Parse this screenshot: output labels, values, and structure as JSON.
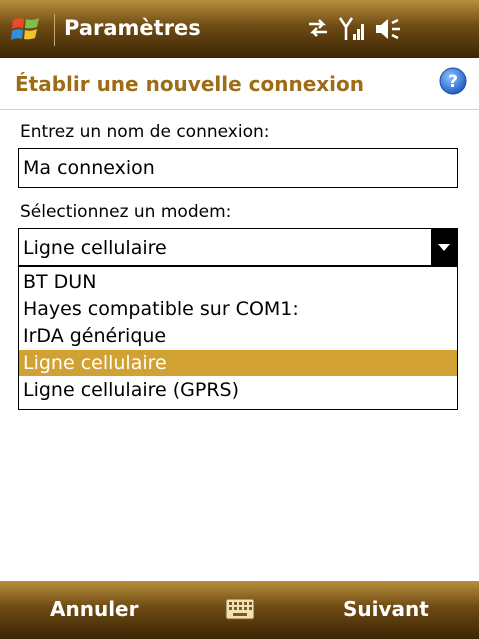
{
  "titlebar": {
    "app_title": "Paramètres",
    "icons": [
      "windows-start-icon",
      "connectivity-icon",
      "signal-icon",
      "volume-icon"
    ]
  },
  "header": {
    "title": "Établir une nouvelle connexion",
    "help_icon": "help-icon"
  },
  "form": {
    "name_label": "Entrez un nom de connexion:",
    "name_value": "Ma connexion",
    "modem_label": "Sélectionnez un modem:",
    "modem_selected": "Ligne cellulaire",
    "modem_options": [
      "BT DUN",
      "Hayes compatible sur COM1:",
      "IrDA générique",
      "Ligne cellulaire",
      "Ligne cellulaire (GPRS)"
    ],
    "highlighted_option": "Ligne cellulaire"
  },
  "softkeys": {
    "left": "Annuler",
    "right": "Suivant",
    "center_icon": "keyboard-icon"
  },
  "colors": {
    "bar_dark": "#3b2505",
    "bar_light": "#b88d3c",
    "header_text": "#9d6c15",
    "highlight": "#d2a133"
  }
}
